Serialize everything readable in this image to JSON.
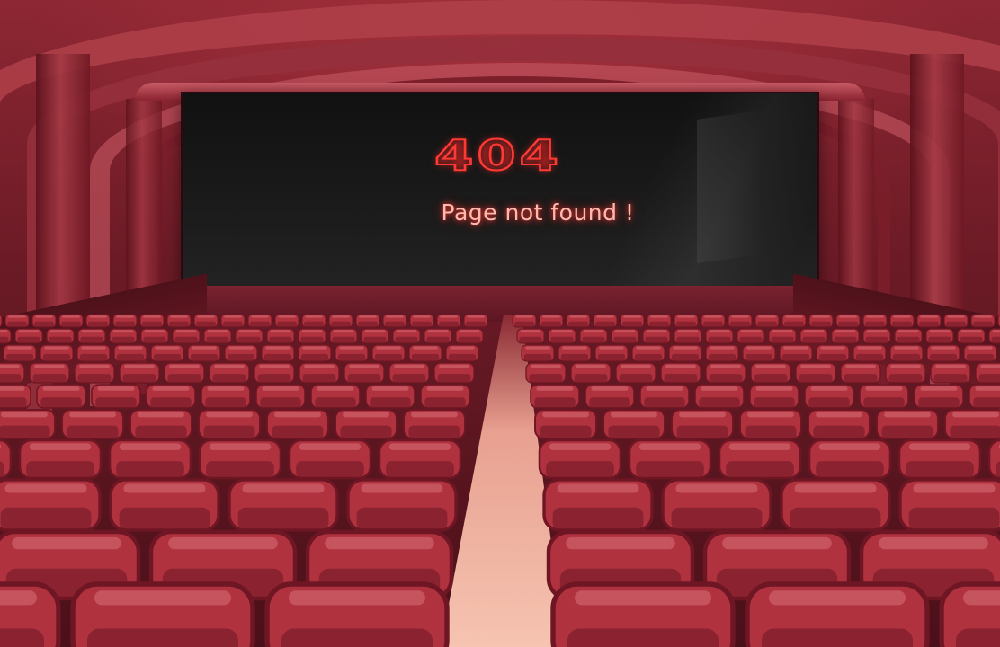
{
  "screen": {
    "code": "404",
    "message": "Page not found !"
  },
  "colors": {
    "accent": "#ff3a34",
    "seat": "#b0323f",
    "seat_dark": "#6e1623",
    "aisle": "#f2b6a3"
  }
}
